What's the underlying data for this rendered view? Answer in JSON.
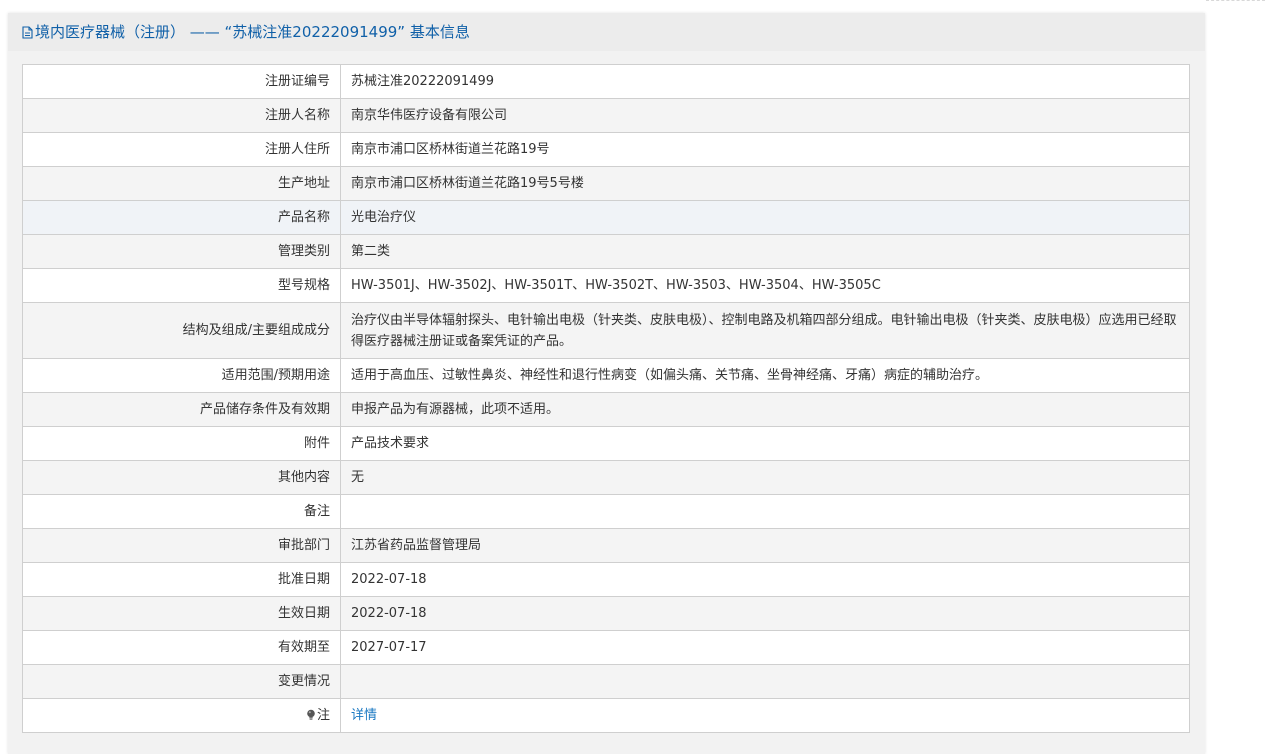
{
  "header": {
    "title": "境内医疗器械（注册） —— “苏械注准20222091499” 基本信息"
  },
  "rows": [
    {
      "label": "注册证编号",
      "value": "苏械注准20222091499"
    },
    {
      "label": "注册人名称",
      "value": "南京华伟医疗设备有限公司"
    },
    {
      "label": "注册人住所",
      "value": "南京市浦口区桥林街道兰花路19号"
    },
    {
      "label": "生产地址",
      "value": "南京市浦口区桥林街道兰花路19号5号楼"
    },
    {
      "label": "产品名称",
      "value": "光电治疗仪"
    },
    {
      "label": "管理类别",
      "value": "第二类"
    },
    {
      "label": "型号规格",
      "value": "HW-3501J、HW-3502J、HW-3501T、HW-3502T、HW-3503、HW-3504、HW-3505C"
    },
    {
      "label": "结构及组成/主要组成成分",
      "value": "治疗仪由半导体辐射探头、电针输出电极（针夹类、皮肤电极）、控制电路及机箱四部分组成。电针输出电极（针夹类、皮肤电极）应选用已经取得医疗器械注册证或备案凭证的产品。"
    },
    {
      "label": "适用范围/预期用途",
      "value": "适用于高血压、过敏性鼻炎、神经性和退行性病变（如偏头痛、关节痛、坐骨神经痛、牙痛）病症的辅助治疗。"
    },
    {
      "label": "产品储存条件及有效期",
      "value": "申报产品为有源器械，此项不适用。"
    },
    {
      "label": "附件",
      "value": "产品技术要求"
    },
    {
      "label": "其他内容",
      "value": "无"
    },
    {
      "label": "备注",
      "value": ""
    },
    {
      "label": "审批部门",
      "value": "江苏省药品监督管理局"
    },
    {
      "label": "批准日期",
      "value": "2022-07-18"
    },
    {
      "label": "生效日期",
      "value": "2022-07-18"
    },
    {
      "label": "有效期至",
      "value": "2027-07-17"
    },
    {
      "label": "变更情况",
      "value": ""
    }
  ],
  "note": {
    "label": "注",
    "link_text": "详情",
    "icon": "lightbulb-icon"
  },
  "colors": {
    "title": "#1060a8",
    "link": "#1a78c2",
    "border": "#cfcfcf"
  }
}
